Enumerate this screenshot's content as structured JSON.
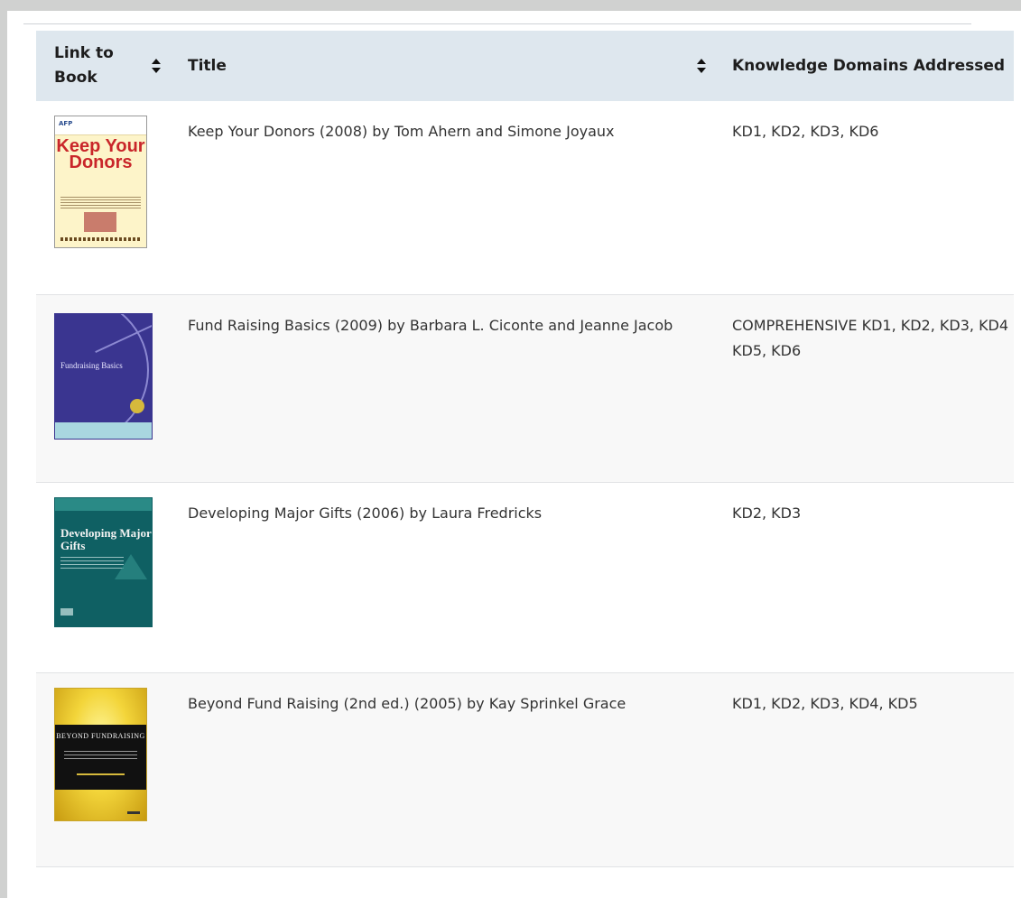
{
  "table": {
    "headers": {
      "link": "Link to Book",
      "title": "Title",
      "kd": "Knowledge Domains Addressed"
    },
    "rows": [
      {
        "title": "Keep Your Donors (2008) by Tom Ahern and Simone Joyaux",
        "kd_line1": "KD1, KD2, KD3, KD6",
        "kd_line2": "",
        "cover_icon": "book-cover-keep-your-donors"
      },
      {
        "title": "Fund Raising Basics (2009) by Barbara L. Ciconte and Jeanne Jacob",
        "kd_line1": "COMPREHENSIVE KD1, KD2, KD3, KD4",
        "kd_line2": "KD5, KD6",
        "cover_icon": "book-cover-fundraising-basics"
      },
      {
        "title": "Developing Major Gifts (2006) by Laura Fredricks",
        "kd_line1": "KD2, KD3",
        "kd_line2": "",
        "cover_icon": "book-cover-developing-major-gifts"
      },
      {
        "title": "Beyond Fund Raising (2nd ed.) (2005) by Kay Sprinkel Grace",
        "kd_line1": "KD1, KD2, KD3, KD4, KD5",
        "kd_line2": "",
        "cover_icon": "book-cover-beyond-fundraising"
      }
    ]
  },
  "covers": {
    "keep_your_donors": {
      "publisher": "AFP",
      "title": "Keep Your Donors"
    },
    "fundraising_basics": {
      "title": "Fundraising Basics"
    },
    "developing_major_gifts": {
      "title": "Developing Major Gifts"
    },
    "beyond_fundraising": {
      "title": "BEYOND FUNDRAISING"
    }
  },
  "colors": {
    "header_bg": "#dee7ee",
    "alt_row_bg": "#f8f8f8",
    "text": "#333333",
    "border": "#e1e3e5"
  }
}
